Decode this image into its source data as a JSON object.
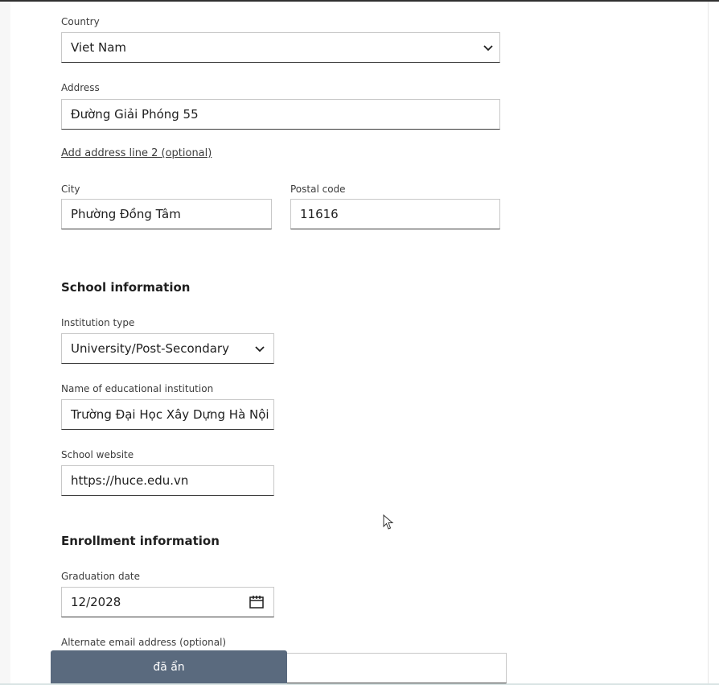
{
  "address_section": {
    "country_label": "Country",
    "country_value": "Viet Nam",
    "address_label": "Address",
    "address_value": "Đường Giải Phóng 55",
    "add_line2_link": "Add address line 2 (optional)",
    "city_label": "City",
    "city_value": "Phường Đồng Tâm",
    "postal_label": "Postal code",
    "postal_value": "11616"
  },
  "school_section": {
    "heading": "School information",
    "institution_type_label": "Institution type",
    "institution_type_value": "University/Post-Secondary",
    "institution_name_label": "Name of educational institution",
    "institution_name_value": "Trường Đại Học Xây Dựng Hà Nội",
    "website_label": "School website",
    "website_value": "https://huce.edu.vn"
  },
  "enrollment_section": {
    "heading": "Enrollment information",
    "graduation_label": "Graduation date",
    "graduation_value": "12/2028",
    "alt_email_label": "Alternate email address (optional)",
    "alt_email_value": ""
  },
  "toast": {
    "text": "đã ẩn"
  },
  "icons": {
    "country_dropdown": "chevron-down-icon",
    "institution_dropdown": "chevron-down-icon",
    "graduation_picker": "calendar-icon",
    "pointer": "mouse-cursor-icon"
  }
}
